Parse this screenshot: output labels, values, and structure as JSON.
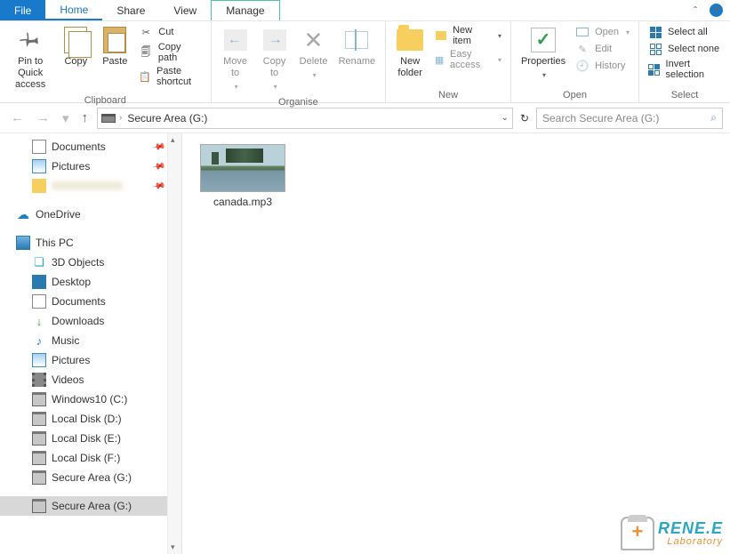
{
  "tabs": {
    "file": "File",
    "home": "Home",
    "share": "Share",
    "view": "View",
    "manage": "Manage"
  },
  "ribbon": {
    "clipboard": {
      "label": "Clipboard",
      "pin": "Pin to Quick\naccess",
      "copy": "Copy",
      "paste": "Paste",
      "cut": "Cut",
      "copypath": "Copy path",
      "pasteshortcut": "Paste shortcut"
    },
    "organise": {
      "label": "Organise",
      "moveto": "Move\nto",
      "copyto": "Copy\nto",
      "delete": "Delete",
      "rename": "Rename"
    },
    "new": {
      "label": "New",
      "newfolder": "New\nfolder",
      "newitem": "New item",
      "easyaccess": "Easy access"
    },
    "open": {
      "label": "Open",
      "properties": "Properties",
      "open": "Open",
      "edit": "Edit",
      "history": "History"
    },
    "select": {
      "label": "Select",
      "all": "Select all",
      "none": "Select none",
      "invert": "Invert selection"
    }
  },
  "address": {
    "location": "Secure Area (G:)"
  },
  "search": {
    "placeholder": "Search Secure Area (G:)"
  },
  "tree": {
    "quick": [
      {
        "label": "Documents",
        "icon": "doc",
        "pin": true
      },
      {
        "label": "Pictures",
        "icon": "pic",
        "pin": true
      },
      {
        "label": "",
        "icon": "fold",
        "pin": true,
        "blurred": true
      }
    ],
    "onedrive": "OneDrive",
    "thispc": "This PC",
    "pcchildren": [
      {
        "label": "3D Objects",
        "icon": "obj3d"
      },
      {
        "label": "Desktop",
        "icon": "desk"
      },
      {
        "label": "Documents",
        "icon": "doc"
      },
      {
        "label": "Downloads",
        "icon": "dl"
      },
      {
        "label": "Music",
        "icon": "music"
      },
      {
        "label": "Pictures",
        "icon": "pic"
      },
      {
        "label": "Videos",
        "icon": "vid"
      },
      {
        "label": "Windows10 (C:)",
        "icon": "drive"
      },
      {
        "label": "Local Disk (D:)",
        "icon": "drive"
      },
      {
        "label": "Local Disk (E:)",
        "icon": "drive"
      },
      {
        "label": "Local Disk (F:)",
        "icon": "drive"
      },
      {
        "label": "Secure Area (G:)",
        "icon": "drive"
      }
    ],
    "bottom": {
      "label": "Secure Area (G:)",
      "icon": "drive"
    }
  },
  "files": [
    {
      "name": "canada.mp3"
    }
  ],
  "watermark": {
    "l1": "RENE.E",
    "l2": "Laboratory"
  }
}
